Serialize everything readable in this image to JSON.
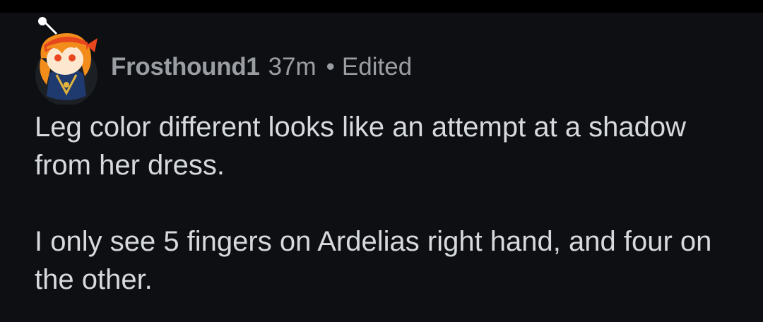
{
  "comment": {
    "author": "Frosthound1",
    "time": "37m",
    "separator": "•",
    "edited": "Edited",
    "paragraphs": [
      "Leg color different looks like an attempt at a shadow from her dress.",
      "I only see 5 fingers on Ardelias right hand, and four on the other."
    ],
    "avatar_icon": "snoo-avatar-icon"
  },
  "colors": {
    "background": "#0d0f12",
    "text": "#d7dadc",
    "meta": "#9a9ea3",
    "avatar_hair": "#f28c1b",
    "avatar_bandana": "#e8461e",
    "avatar_outfit": "#1e3a6e"
  }
}
